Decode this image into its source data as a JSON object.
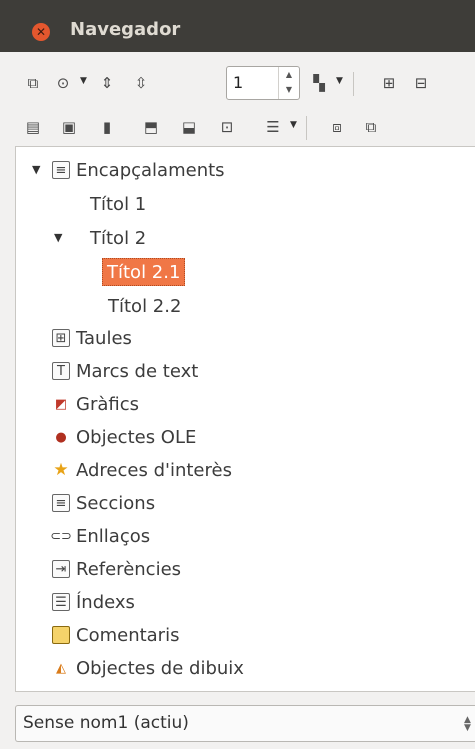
{
  "window": {
    "title": "Navegador"
  },
  "toolbar": {
    "page_number": "1"
  },
  "tree": {
    "headings_label": "Encapçalaments",
    "heading1": "Títol 1",
    "heading2": "Títol 2",
    "heading2_1": "Títol 2.1",
    "heading2_2": "Títol 2.2",
    "categories": [
      "Taules",
      "Marcs de text",
      "Gràfics",
      "Objectes OLE",
      "Adreces d'interès",
      "Seccions",
      "Enllaços",
      "Referències",
      "Índexs",
      "Comentaris",
      "Objectes de dibuix"
    ]
  },
  "document_select": {
    "value": "Sense nom1 (actiu)"
  }
}
